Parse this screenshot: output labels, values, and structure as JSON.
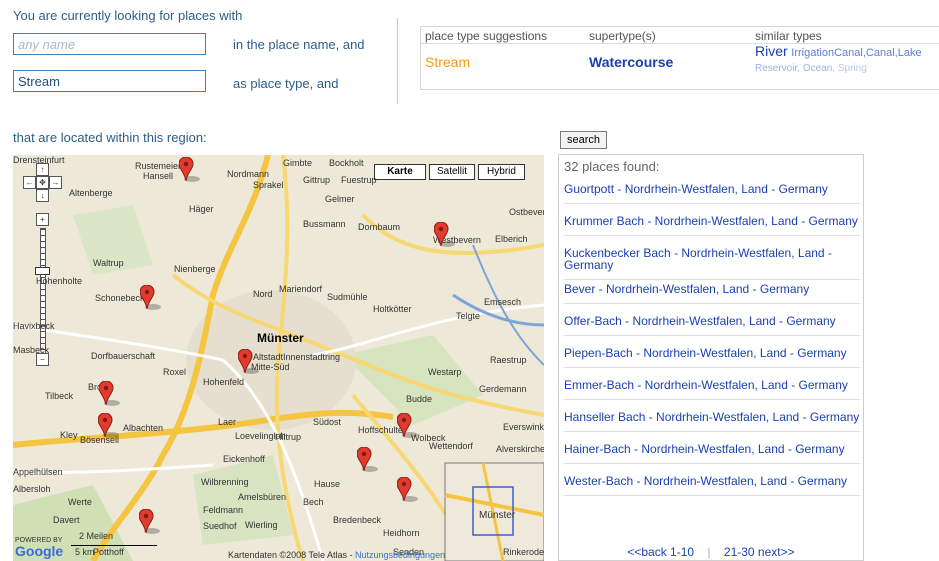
{
  "query": {
    "intro": "You are currently looking for places with",
    "name_placeholder": "any name",
    "name_suffix": "in the place name, and",
    "type_value": "Stream",
    "type_suffix": "as place type, and",
    "region_text": "that are located within this region:"
  },
  "suggestions": {
    "headers": [
      "place type suggestions",
      "supertype(s)",
      "similar types"
    ],
    "type": "Stream",
    "supertype": "Watercourse",
    "similar_main": "River",
    "similar_types": [
      "IrrigationCanal",
      "Canal",
      "Lake"
    ],
    "similar_minor": [
      "Reservoir",
      "Ocean",
      "Spring"
    ]
  },
  "search_button": "search",
  "results": {
    "count": "32 places found:",
    "items": [
      "Guortpott - Nordrhein-Westfalen, Land - Germany",
      "Krummer Bach - Nordrhein-Westfalen, Land - Germany",
      "Kuckenbecker Bach - Nordrhein-Westfalen, Land - Germany",
      "Bever - Nordrhein-Westfalen, Land - Germany",
      "Offer-Bach - Nordrhein-Westfalen, Land - Germany",
      "Piepen-Bach - Nordrhein-Westfalen, Land - Germany",
      "Emmer-Bach - Nordrhein-Westfalen, Land - Germany",
      "Hanseller Bach - Nordrhein-Westfalen, Land - Germany",
      "Hainer-Bach - Nordrhein-Westfalen, Land - Germany",
      "Wester-Bach - Nordrhein-Westfalen, Land - Germany"
    ],
    "back": "<<back 1-10",
    "next": "21-30 next>>"
  },
  "map": {
    "buttons": [
      "Karte",
      "Satellit",
      "Hybrid"
    ],
    "city": "Münster",
    "labels": [
      "Gimbte",
      "Bockholt",
      "Altenberge",
      "Hansell",
      "Nordmann",
      "Rustemeier",
      "Sprakel",
      "Gittrup",
      "Fuestrup",
      "Gelmer",
      "Häger",
      "Bussmann",
      "Dornbaum",
      "Westbevern",
      "Elberich",
      "Ostbevern",
      "Waltrup",
      "Nienberge",
      "Nord",
      "Mariendorf",
      "Sudmühle",
      "Holtkötter",
      "Telgte",
      "Emsesch",
      "Hohenholte",
      "Schonebeck",
      "Havixbeck",
      "Masbeck",
      "Dorfbauerschaft",
      "Altstadt",
      "Innenstadtring",
      "Roxel",
      "Hohenfeld",
      "Mitte-Süd",
      "Westarp",
      "Raestrup",
      "Gerdemann",
      "Tilbeck",
      "Brock",
      "Laer",
      "Budde",
      "Albachten",
      "Loevelingloh",
      "Südost",
      "Hoffschulte",
      "Wolbeck",
      "Everswinkel",
      "Bösensell",
      "Kley",
      "Hiltrup",
      "Eickenhoff",
      "Alverskirchen",
      "Wettendorf",
      "Appelhülsen",
      "Wilbrenning",
      "Amelsbüren",
      "Feldmann",
      "Hause",
      "Bech",
      "Heidhorn",
      "Albersloh",
      "Werte",
      "Bredenbeck",
      "Davert",
      "Wierling",
      "Suedhof",
      "Potthoff",
      "Senden",
      "Rinkerode",
      "Drensteinfurt"
    ],
    "scale_miles": "2 Meilen",
    "scale_km": "5 km",
    "copyright": "Kartendaten ©2008 Tele Atlas -",
    "terms": "Nutzungsbedingungen",
    "logo": "Google",
    "powered": "POWERED BY",
    "overview_city": "Münster",
    "road_numbers": [
      "54",
      "1",
      "E37",
      "219",
      "1",
      "51",
      "54",
      "43",
      "43",
      "51",
      "1"
    ]
  }
}
